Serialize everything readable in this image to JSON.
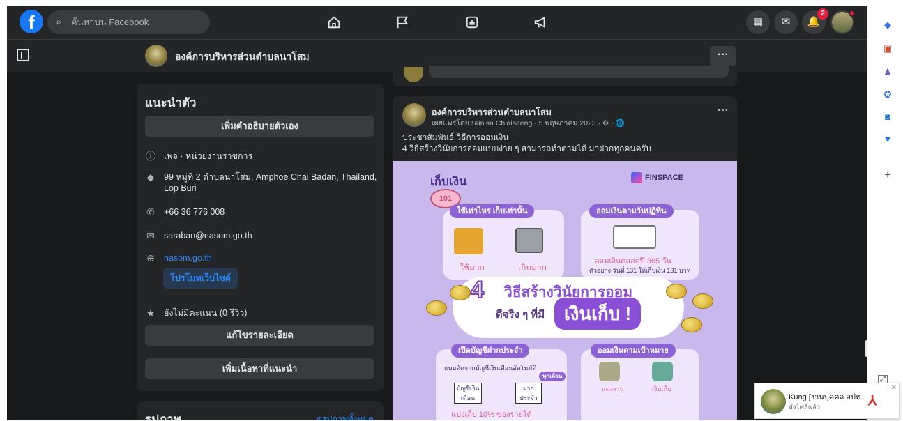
{
  "topbar": {
    "search_placeholder": "ค้นหาบน Facebook",
    "notification_count": "2"
  },
  "page_header": {
    "page_name": "องค์การบริหารส่วนตำบลนาโสม",
    "more_label": "···"
  },
  "intro": {
    "title": "แนะนำตัว",
    "add_bio_button": "เพิ่มคำอธิบายตัวเอง",
    "category": "เพจ · หน่วยงานราชการ",
    "address": "99 หมู่ที่ 2 ตำบลนาโสม, Amphoe Chai Badan, Thailand, Lop Buri",
    "phone": "+66 36 776 008",
    "email": "saraban@nasom.go.th",
    "website": "nasom.go.th",
    "promote_button": "โปรโมทเว็บไซต์",
    "rating": "ยังไม่มีคะแนน (0 รีวิว)",
    "edit_details_button": "แก้ไขรายละเอียด",
    "add_featured_button": "เพิ่มเนื้อหาที่แนะนำ"
  },
  "photos": {
    "title": "รูปภาพ",
    "see_all": "ดูรูปภาพทั้งหมด"
  },
  "post": {
    "author": "องค์การบริหารส่วนตำบลนาโสม",
    "meta": "เผยแพร่โดย Sunisa Chlaisaeng · 5 พฤษภาคม 2023 · ⚙ · 🌐",
    "line1": "ประชาสัมพันธ์ วิธีการออมเงิน",
    "line2": "4 วิธีสร้างวินัยการออมแบบง่าย ๆ สามารถทำตามได้ มาฝากทุกคนครับ",
    "dots": "···"
  },
  "infographic": {
    "header": "เก็บเงิน",
    "piggy_label": "101",
    "brand": "FINSPACE",
    "panel1_tag": "ใช้เท่าไหร่ เก็บเท่านั้น",
    "panel1_left": "ใช้มาก",
    "panel1_right": "เก็บมาก",
    "panel2_tag": "ออมเงินตามวันปฏิทิน",
    "panel2_text": "ออมเงินตลอดปี 365 วัน",
    "panel2_sub": "ตัวอย่าง วันที่ 131 ให้เก็บเงิน 131 บาท",
    "center_number": "4",
    "center_title": "วิธีสร้างวินัยการออม",
    "center_sub": "ดีจริง ๆ ที่มี",
    "center_box": "เงินเก็บ !",
    "panel3_tag": "เปิดบัญชีฝากประจำ",
    "panel3_text": "แบบตัดจากบัญชีเงินเดือนอัตโนมัติ",
    "panel3_a": "บัญชีเงินเดือน",
    "panel3_b": "ฝากประจำ",
    "panel3_badge": "ทุกเดือน",
    "panel3_bottom": "แบ่งเก็บ 10% ของรายได้",
    "panel4_tag": "ออมเงินตามเป้าหมาย",
    "panel4_a": "แต่งงาน",
    "panel4_b": "เงินเก็บ"
  },
  "toast": {
    "name": "Kung [งานบุคคล อปท...",
    "sub": "ส่งไฟล์แล้ว"
  },
  "colors": {
    "bg": "#18191a",
    "card": "#242526",
    "accent": "#2d88ff",
    "brand": "#1877f2"
  }
}
